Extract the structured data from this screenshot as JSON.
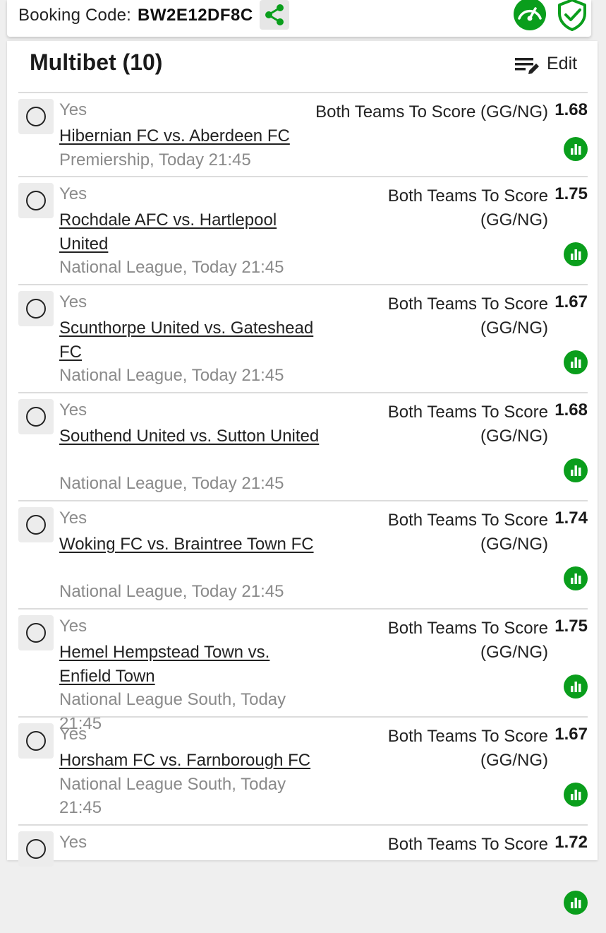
{
  "header": {
    "booking_label": "Booking Code:",
    "booking_code": "BW2E12DF8C",
    "share_icon": "share-icon",
    "speedometer_icon": "speedometer-icon",
    "shield_icon": "shield-check-icon",
    "accent_color": "#0a9e1c"
  },
  "betslip": {
    "title": "Multibet (10)",
    "edit_label": "Edit",
    "selections": [
      {
        "pick": "Yes",
        "match": "Hibernian FC vs. Aberdeen FC",
        "league": "Premiership, Today 21:45",
        "market": "Both Teams To Score (GG/NG)",
        "odds": "1.68"
      },
      {
        "pick": "Yes",
        "match": "Rochdale AFC vs. Hartlepool United",
        "league": "National League, Today 21:45",
        "market": "Both Teams To Score (GG/NG)",
        "odds": "1.75"
      },
      {
        "pick": "Yes",
        "match": "Scunthorpe United vs. Gateshead FC",
        "league": "National League, Today 21:45",
        "market": "Both Teams To Score (GG/NG)",
        "odds": "1.67"
      },
      {
        "pick": "Yes",
        "match": "Southend United vs. Sutton United",
        "league": "National League, Today 21:45",
        "market": "Both Teams To Score (GG/NG)",
        "odds": "1.68"
      },
      {
        "pick": "Yes",
        "match": "Woking FC vs. Braintree Town FC",
        "league": "National League, Today 21:45",
        "market": "Both Teams To Score (GG/NG)",
        "odds": "1.74"
      },
      {
        "pick": "Yes",
        "match": "Hemel Hempstead Town vs. Enfield Town",
        "league": "National League South, Today 21:45",
        "market": "Both Teams To Score (GG/NG)",
        "odds": "1.75"
      },
      {
        "pick": "Yes",
        "match": "Horsham FC vs. Farnborough FC",
        "league": "National League South, Today 21:45",
        "market": "Both Teams To Score (GG/NG)",
        "odds": "1.67"
      },
      {
        "pick": "Yes",
        "match": "",
        "league": "",
        "market": "Both Teams To Score",
        "odds": "1.72"
      }
    ]
  }
}
